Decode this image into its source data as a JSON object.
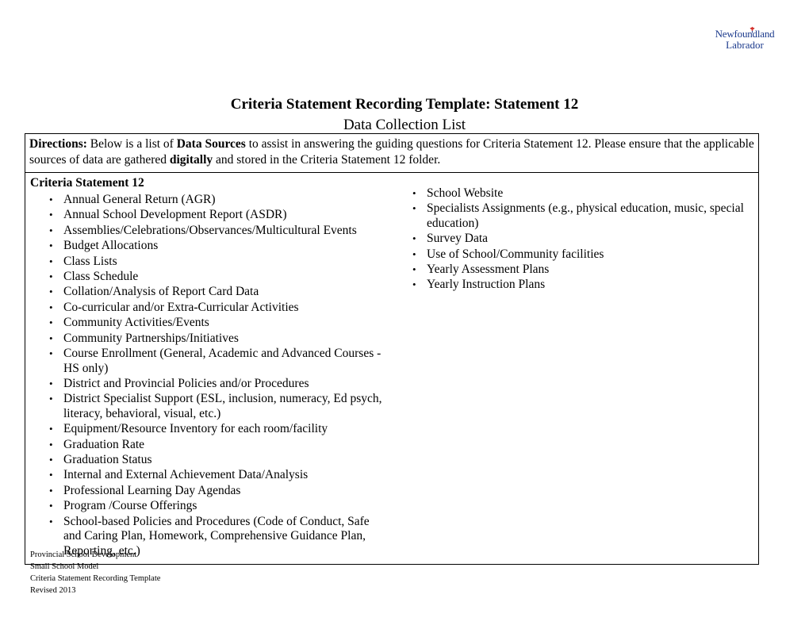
{
  "logo": {
    "line1": "Newfoundland",
    "line2": "Labrador",
    "mark": "pitcher-plant-icon",
    "color": "#1b3a8c",
    "mark_color": "#d4322c"
  },
  "title": {
    "heading": "Criteria Statement Recording Template: Statement 12",
    "subheading": "Data Collection List"
  },
  "directions": {
    "label": "Directions:",
    "text_1": " Below is a list of ",
    "bold_1": "Data Sources",
    "text_2": " to assist in answering the guiding questions for Criteria Statement 12. Please ensure that the applicable sources of data are gathered ",
    "bold_2": "digitally",
    "text_3": " and stored in the Criteria Statement 12 folder."
  },
  "left_column": {
    "heading": "Criteria Statement 12",
    "items": [
      "Annual General Return (AGR)",
      "Annual School Development Report (ASDR)",
      "Assemblies/Celebrations/Observances/Multicultural Events",
      "Budget Allocations",
      "Class Lists",
      "Class Schedule",
      "Collation/Analysis of Report Card Data",
      "Co-curricular and/or Extra-Curricular Activities",
      "Community Activities/Events",
      "Community Partnerships/Initiatives",
      "Course Enrollment (General, Academic and Advanced Courses - HS only)",
      "District and Provincial Policies and/or Procedures",
      "District Specialist Support (ESL, inclusion, numeracy, Ed psych, literacy, behavioral, visual, etc.)",
      "Equipment/Resource Inventory for each room/facility",
      "Graduation Rate",
      "Graduation Status",
      "Internal and External Achievement Data/Analysis",
      "Professional Learning Day Agendas",
      "Program /Course Offerings",
      "School-based Policies and Procedures (Code of Conduct, Safe and Caring Plan, Homework, Comprehensive Guidance Plan, Reporting, etc.)"
    ]
  },
  "right_column": {
    "items": [
      "School Website",
      "Specialists Assignments (e.g., physical education, music, special education)",
      "Survey Data",
      "Use of School/Community facilities",
      "Yearly Assessment Plans",
      "Yearly Instruction Plans"
    ]
  },
  "footer": {
    "line1": "Provincial School Development",
    "line2": "Small School Model",
    "line3": "Criteria Statement Recording Template",
    "line4": "Revised 2013"
  }
}
